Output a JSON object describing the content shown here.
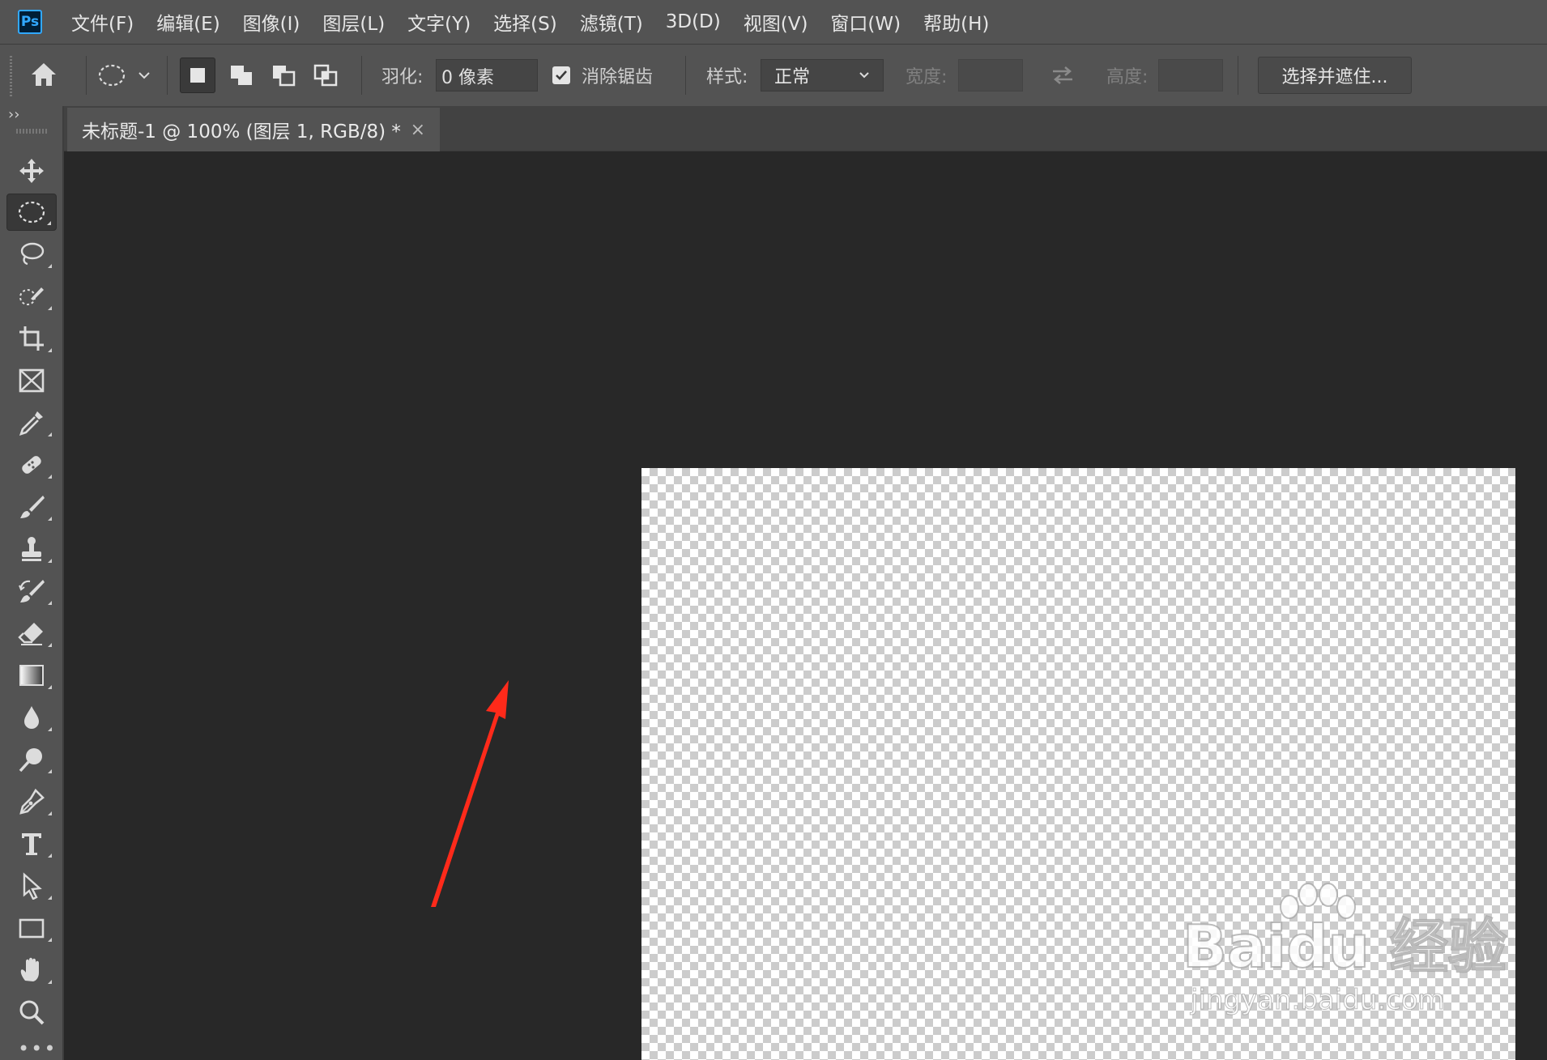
{
  "app": {
    "logo_text": "Ps"
  },
  "menu": [
    {
      "label": "文件(F)"
    },
    {
      "label": "编辑(E)"
    },
    {
      "label": "图像(I)"
    },
    {
      "label": "图层(L)"
    },
    {
      "label": "文字(Y)"
    },
    {
      "label": "选择(S)"
    },
    {
      "label": "滤镜(T)"
    },
    {
      "label": "3D(D)"
    },
    {
      "label": "视图(V)"
    },
    {
      "label": "窗口(W)"
    },
    {
      "label": "帮助(H)"
    }
  ],
  "options": {
    "feather_label": "羽化:",
    "feather_value": "0 像素",
    "antialias_label": "消除锯齿",
    "antialias_checked": true,
    "style_label": "样式:",
    "style_value": "正常",
    "width_label": "宽度:",
    "height_label": "高度:",
    "refine_button": "选择并遮住..."
  },
  "toolbox": {
    "collapse_glyph": "››",
    "more_glyph": "•••",
    "tools": [
      {
        "icon": "move-tool-icon"
      },
      {
        "icon": "elliptical-marquee-icon",
        "active": true
      },
      {
        "icon": "lasso-icon"
      },
      {
        "icon": "quick-selection-icon"
      },
      {
        "icon": "crop-icon"
      },
      {
        "icon": "frame-icon"
      },
      {
        "icon": "eyedropper-icon"
      },
      {
        "icon": "healing-brush-icon"
      },
      {
        "icon": "brush-icon"
      },
      {
        "icon": "clone-stamp-icon"
      },
      {
        "icon": "history-brush-icon"
      },
      {
        "icon": "eraser-icon"
      },
      {
        "icon": "gradient-icon"
      },
      {
        "icon": "blur-icon"
      },
      {
        "icon": "dodge-icon"
      },
      {
        "icon": "pen-icon"
      },
      {
        "icon": "type-icon"
      },
      {
        "icon": "path-selection-icon"
      },
      {
        "icon": "rectangle-icon"
      },
      {
        "icon": "hand-icon"
      },
      {
        "icon": "zoom-icon"
      }
    ]
  },
  "document_tab": {
    "title": "未标题-1 @ 100% (图层 1, RGB/8) *",
    "close_glyph": "×"
  },
  "annotation": {
    "color": "#ff2a1a"
  },
  "watermark": {
    "brand": "Baidu 经验",
    "url": "jingyan.baidu.com"
  }
}
